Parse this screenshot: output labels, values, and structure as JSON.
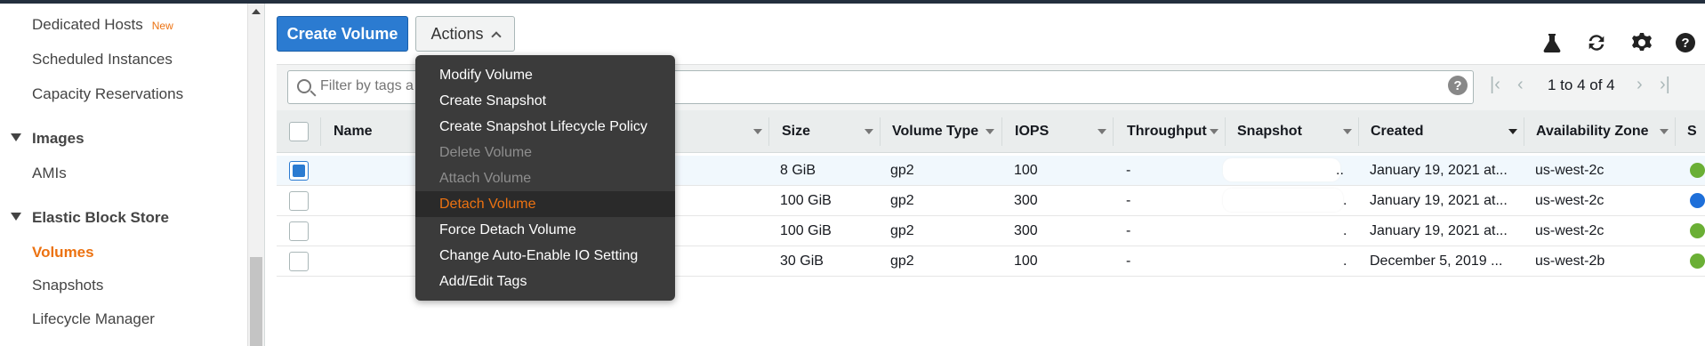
{
  "sidebar": {
    "items_top": [
      {
        "label": "Dedicated Hosts",
        "badge": "New"
      },
      {
        "label": "Scheduled Instances"
      },
      {
        "label": "Capacity Reservations"
      }
    ],
    "section_images": "Images",
    "images_items": [
      {
        "label": "AMIs"
      }
    ],
    "section_ebs": "Elastic Block Store",
    "ebs_items": [
      {
        "label": "Volumes"
      },
      {
        "label": "Snapshots"
      },
      {
        "label": "Lifecycle Manager"
      }
    ]
  },
  "toolbar": {
    "create_label": "Create Volume",
    "actions_label": "Actions"
  },
  "icons": [
    "flask-icon",
    "refresh-icon",
    "gear-icon",
    "help-icon"
  ],
  "filter": {
    "placeholder": "Filter by tags a",
    "help": "?"
  },
  "pagination": {
    "text": "1 to 4 of 4"
  },
  "table": {
    "columns": [
      "Name",
      "Size",
      "Volume Type",
      "IOPS",
      "Throughput",
      "Snapshot",
      "Created",
      "Availability Zone",
      "S"
    ],
    "rows": [
      {
        "selected": true,
        "size": "8 GiB",
        "type": "gp2",
        "iops": "100",
        "throughput": "-",
        "snapshot": "..",
        "created": "January 19, 2021 at...",
        "az": "us-west-2c",
        "status_color": "#6aaf35"
      },
      {
        "selected": false,
        "size": "100 GiB",
        "type": "gp2",
        "iops": "300",
        "throughput": "-",
        "snapshot": ".",
        "created": "January 19, 2021 at...",
        "az": "us-west-2c",
        "status_color": "#1e6fd9"
      },
      {
        "selected": false,
        "size": "100 GiB",
        "type": "gp2",
        "iops": "300",
        "throughput": "-",
        "snapshot": ".",
        "created": "January 19, 2021 at...",
        "az": "us-west-2c",
        "status_color": "#6aaf35"
      },
      {
        "selected": false,
        "size": "30 GiB",
        "type": "gp2",
        "iops": "100",
        "throughput": "-",
        "snapshot": ".",
        "created": "December 5, 2019 ...",
        "az": "us-west-2b",
        "status_color": "#6aaf35"
      }
    ]
  },
  "actions_menu": {
    "items": [
      {
        "label": "Modify Volume",
        "state": "enabled"
      },
      {
        "label": "Create Snapshot",
        "state": "enabled"
      },
      {
        "label": "Create Snapshot Lifecycle Policy",
        "state": "enabled"
      },
      {
        "label": "Delete Volume",
        "state": "disabled"
      },
      {
        "label": "Attach Volume",
        "state": "disabled"
      },
      {
        "label": "Detach Volume",
        "state": "highlighted"
      },
      {
        "label": "Force Detach Volume",
        "state": "enabled"
      },
      {
        "label": "Change Auto-Enable IO Setting",
        "state": "enabled"
      },
      {
        "label": "Add/Edit Tags",
        "state": "enabled"
      }
    ]
  },
  "colors": {
    "accent": "#ec7211",
    "primary": "#2b7bd1",
    "running": "#6aaf35",
    "in_use": "#1e6fd9"
  }
}
